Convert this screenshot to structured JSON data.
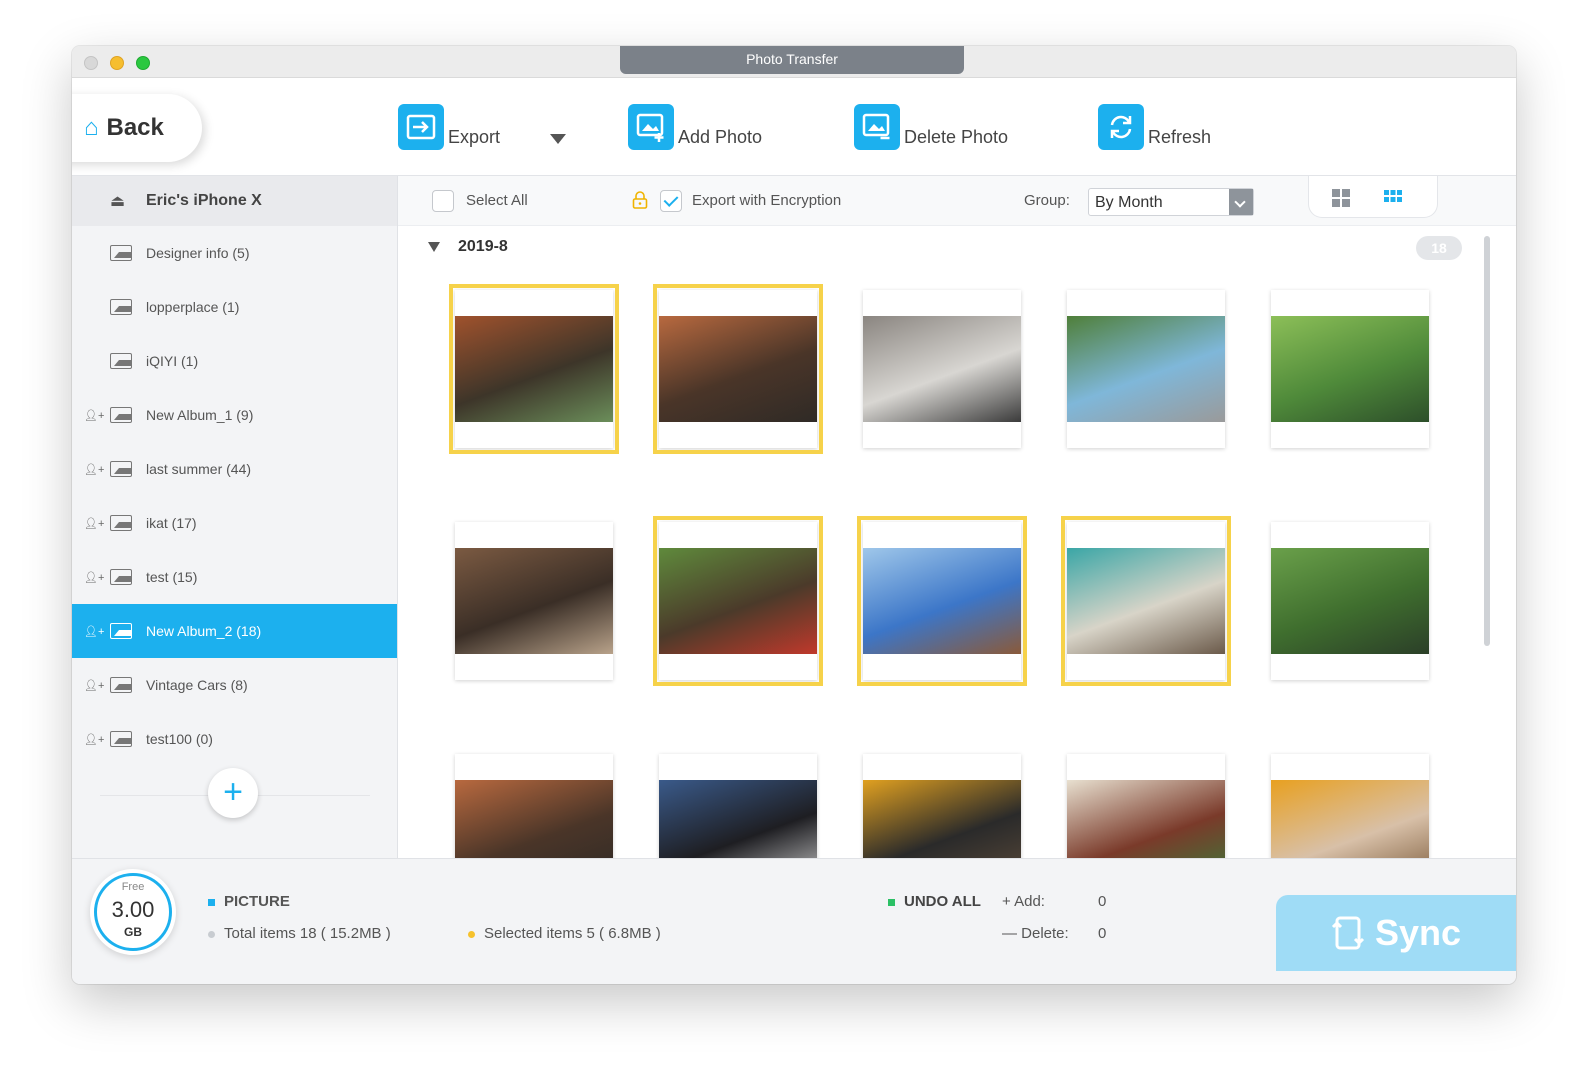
{
  "window": {
    "title": "Photo Transfer"
  },
  "toolbar": {
    "back_label": "Back",
    "export_label": "Export",
    "add_photo_label": "Add Photo",
    "delete_photo_label": "Delete Photo",
    "refresh_label": "Refresh",
    "accent_color": "#1cb0ee"
  },
  "sidebar": {
    "device_name": "Eric's iPhone X",
    "albums": [
      {
        "label": "Designer info (5)",
        "shared": false
      },
      {
        "label": "lopperplace (1)",
        "shared": false
      },
      {
        "label": "iQIYI (1)",
        "shared": false
      },
      {
        "label": "New Album_1 (9)",
        "shared": true
      },
      {
        "label": "last summer (44)",
        "shared": true
      },
      {
        "label": "ikat (17)",
        "shared": true
      },
      {
        "label": "test (15)",
        "shared": true
      },
      {
        "label": "New Album_2 (18)",
        "shared": true,
        "active": true
      },
      {
        "label": "Vintage Cars (8)",
        "shared": true
      },
      {
        "label": "test100 (0)",
        "shared": true
      }
    ],
    "add_album_icon": "plus-icon"
  },
  "filterbar": {
    "select_all_label": "Select All",
    "export_encryption_label": "Export with Encryption",
    "export_encryption_checked": true,
    "group_label": "Group:",
    "group_value": "By Month"
  },
  "gallery": {
    "section_label": "2019-8",
    "section_count": "18",
    "photos": [
      {
        "subject": "cacti pots",
        "selected": true
      },
      {
        "subject": "pizza on table",
        "selected": true
      },
      {
        "subject": "person crouching",
        "selected": false
      },
      {
        "subject": "coastal road",
        "selected": false
      },
      {
        "subject": "father and child in park",
        "selected": false
      },
      {
        "subject": "dog",
        "selected": false
      },
      {
        "subject": "child blowing bubbles",
        "selected": true
      },
      {
        "subject": "city skyline",
        "selected": true
      },
      {
        "subject": "teal door",
        "selected": true
      },
      {
        "subject": "child playing football",
        "selected": false
      },
      {
        "subject": "pizza slices",
        "selected": false
      },
      {
        "subject": "camera",
        "selected": false
      },
      {
        "subject": "food bowls",
        "selected": false
      },
      {
        "subject": "salad plate",
        "selected": false
      },
      {
        "subject": "soup bowl",
        "selected": false
      }
    ]
  },
  "footer": {
    "free_label": "Free",
    "free_value": "3.00",
    "free_unit": "GB",
    "category": "PICTURE",
    "total_items": "Total items 18 ( 15.2MB )",
    "selected_items": "Selected items 5 ( 6.8MB )",
    "undo_all": "UNDO ALL",
    "add_label": "+ Add:",
    "add_value": "0",
    "delete_label": "— Delete:",
    "delete_value": "0",
    "sync_label": "Sync"
  }
}
